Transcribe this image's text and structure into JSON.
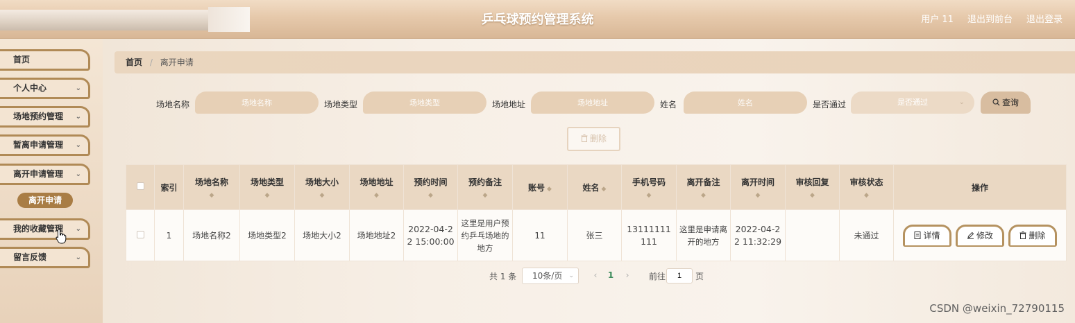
{
  "header": {
    "title": "乒乓球预约管理系统",
    "user": "用户 11",
    "back_to_front": "退出到前台",
    "logout": "退出登录"
  },
  "sidebar": {
    "items": [
      {
        "label": "首页",
        "has_chevron": false
      },
      {
        "label": "个人中心",
        "has_chevron": true
      },
      {
        "label": "场地预约管理",
        "has_chevron": true
      },
      {
        "label": "暂离申请管理",
        "has_chevron": true
      },
      {
        "label": "离开申请管理",
        "has_chevron": true
      },
      {
        "label": "我的收藏管理",
        "has_chevron": true
      },
      {
        "label": "留言反馈",
        "has_chevron": true
      }
    ],
    "active_sub": "离开申请",
    "chevron": "⌄"
  },
  "breadcrumb": {
    "home": "首页",
    "separator": "/",
    "current": "离开申请"
  },
  "search": {
    "fields": [
      {
        "label": "场地名称",
        "placeholder": "场地名称"
      },
      {
        "label": "场地类型",
        "placeholder": "场地类型"
      },
      {
        "label": "场地地址",
        "placeholder": "场地地址"
      },
      {
        "label": "姓名",
        "placeholder": "姓名"
      }
    ],
    "status_label": "是否通过",
    "status_placeholder": "是否通过",
    "button": "查询",
    "search_icon": "search-icon"
  },
  "toolbar": {
    "delete": "删除",
    "delete_icon": "trash-icon"
  },
  "table": {
    "headers": [
      "索引",
      "场地名称",
      "场地类型",
      "场地大小",
      "场地地址",
      "预约时间",
      "预约备注",
      "账号",
      "姓名",
      "手机号码",
      "离开备注",
      "离开时间",
      "审核回复",
      "审核状态",
      "操作"
    ],
    "rows": [
      {
        "index": "1",
        "venue_name": "场地名称2",
        "venue_type": "场地类型2",
        "venue_size": "场地大小2",
        "venue_address": "场地地址2",
        "booking_time": "2022-04-22 15:00:00",
        "booking_note": "这里是用户预约乒乓场地的地方",
        "account": "11",
        "name": "张三",
        "phone": "13111111111",
        "leave_note": "这里是申请离开的地方",
        "leave_time": "2022-04-22 11:32:29",
        "review_reply": "",
        "review_status": "未通过"
      }
    ],
    "actions": {
      "detail": "详情",
      "edit": "修改",
      "delete": "删除"
    }
  },
  "pagination": {
    "total": "共 1 条",
    "page_size": "10条/页",
    "current_page": "1",
    "goto": "前往",
    "jump_value": "1",
    "page_unit": "页",
    "prev": "‹",
    "next": "›"
  },
  "watermark": "CSDN @weixin_72790115",
  "colors": {
    "accent": "#b08a56",
    "header": "#d8b796",
    "sub_active": "#a97d45"
  }
}
